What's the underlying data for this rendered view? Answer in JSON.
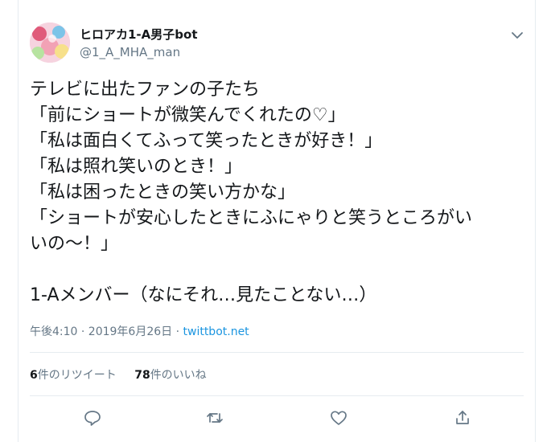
{
  "user": {
    "display_name": "ヒロアカ1-A男子bot",
    "handle": "@1_A_MHA_man"
  },
  "tweet": {
    "lines": [
      "テレビに出たファンの子たち",
      "「前にショートが微笑んでくれたの♡」",
      "「私は面白くてふって笑ったときが好き！」",
      "「私は照れ笑いのとき！」",
      "「私は困ったときの笑い方かな」",
      "「ショートが安心したときにふにゃりと笑うところがい",
      "いの～！」",
      "",
      "1-Aメンバー（なにそれ…見たことない…）"
    ],
    "timestamp": "午後4:10 · 2019年6月26日",
    "separator": " · ",
    "source": "twittbot.net"
  },
  "stats": {
    "retweets_count": "6",
    "retweets_label": "件のリツイート",
    "likes_count": "78",
    "likes_label": "件のいいね"
  },
  "colors": {
    "link": "#1b95e0",
    "secondary_text": "#657786",
    "border": "#e6ecf0"
  },
  "icons": [
    "chevron-down-icon",
    "reply-icon",
    "retweet-icon",
    "like-icon",
    "share-icon"
  ]
}
